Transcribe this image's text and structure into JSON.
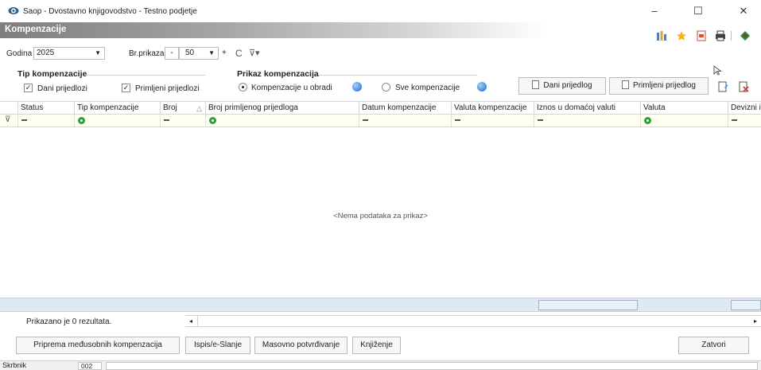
{
  "window": {
    "title": "Saop - Dvostavno knjigovodstvo - Testno podjetje",
    "minimize": "–",
    "maximize": "☐",
    "close": "✕"
  },
  "module": {
    "title": "Kompenzacije"
  },
  "filters": {
    "year_label": "Godina",
    "year_value": "2025",
    "count_label": "Br.prikaza",
    "count_minus": "-",
    "count_value": "50",
    "count_plus": "+",
    "refresh_icon": "C",
    "filter_icon": "⊽▾"
  },
  "tip_group": {
    "title": "Tip kompenzacije",
    "given_label": "Dani prijedlozi",
    "received_label": "Primljeni prijedlozi",
    "given_checked": true,
    "received_checked": true
  },
  "prikaz_group": {
    "title": "Prikaz kompenzacija",
    "option_processing": "Kompenzacije u obradi",
    "option_all": "Sve kompenzacije",
    "selected": "option_processing"
  },
  "top_buttons": {
    "given": "Dani prijedlog",
    "received": "Primljeni prijedlog"
  },
  "grid": {
    "columns": [
      "Status",
      "Tip kompenzacije",
      "Broj",
      "Broj primljenog prijedloga",
      "Datum kompenzacije",
      "Valuta kompenzacije",
      "Iznos u domaćoj valuti",
      "Valuta",
      "Devizni i"
    ],
    "sort_indicator": "△",
    "filter_row_icon": "⊽",
    "empty_message": "<Nema podataka za prikaz>"
  },
  "footer": {
    "result_text": "Prikazano je 0 rezultata.",
    "scroll_left": "◂",
    "scroll_right": "▸"
  },
  "bottom_buttons": {
    "prepare": "Priprema međusobnih kompenzacija",
    "print": "Ispis/e-Slanje",
    "mass_confirm": "Masovno potvrđivanje",
    "posting": "Knjiženje",
    "close": "Zatvori"
  },
  "statusbar": {
    "user_label": "Skrbnik",
    "user_value": "002"
  },
  "colors": {
    "module_bar_start": "#7e7e7e",
    "filter_row": "#fffff1",
    "summary_bar": "#dfe9f4",
    "accent_green": "#2e9e3c"
  },
  "icons": {
    "app": "eye-icon",
    "toolbar": [
      "columns-icon",
      "star-icon",
      "pdf-icon",
      "print-icon",
      "green-diamond-icon"
    ],
    "right_actions": [
      "edit-doc-icon",
      "delete-doc-icon"
    ],
    "cursor": "mouse-pointer-icon"
  }
}
